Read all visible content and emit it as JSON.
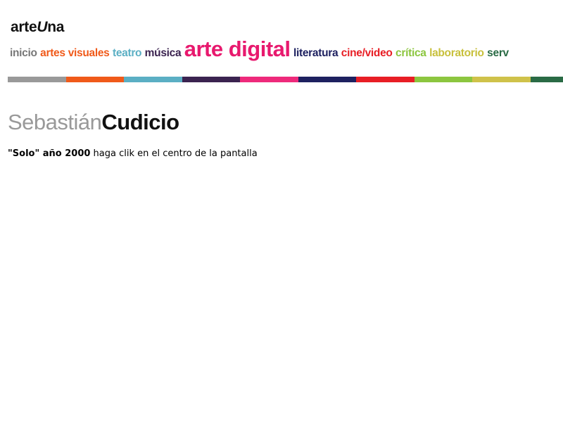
{
  "site": {
    "logo_prefix": "arte",
    "logo_u": "U",
    "logo_suffix": "na"
  },
  "nav": [
    {
      "label": "inicio",
      "color": "#777777"
    },
    {
      "label": "artes visuales",
      "color": "#f05a1a"
    },
    {
      "label": "teatro",
      "color": "#5bafc4"
    },
    {
      "label": "música",
      "color": "#3b2350"
    },
    {
      "label": "arte digital",
      "color": "#e8196e"
    },
    {
      "label": "literatura",
      "color": "#1e2160"
    },
    {
      "label": "cine/video",
      "color": "#e81e25"
    },
    {
      "label": "crítica",
      "color": "#8cc63f"
    },
    {
      "label": "laboratorio",
      "color": "#c8c03c"
    },
    {
      "label": "serv",
      "color": "#2a6b45"
    }
  ],
  "colorbar": [
    "#999999",
    "#f05a1a",
    "#5bafc4",
    "#3b2350",
    "#ee2a7b",
    "#1e2160",
    "#e81e25",
    "#8cc63f",
    "#cfc24a",
    "#2a6b45"
  ],
  "artist": {
    "first_name": "Sebastián",
    "last_name": "Cudicio"
  },
  "work": {
    "title": "\"Solo\" año 2000",
    "instruction": " haga clik en el centro de la pantalla"
  }
}
